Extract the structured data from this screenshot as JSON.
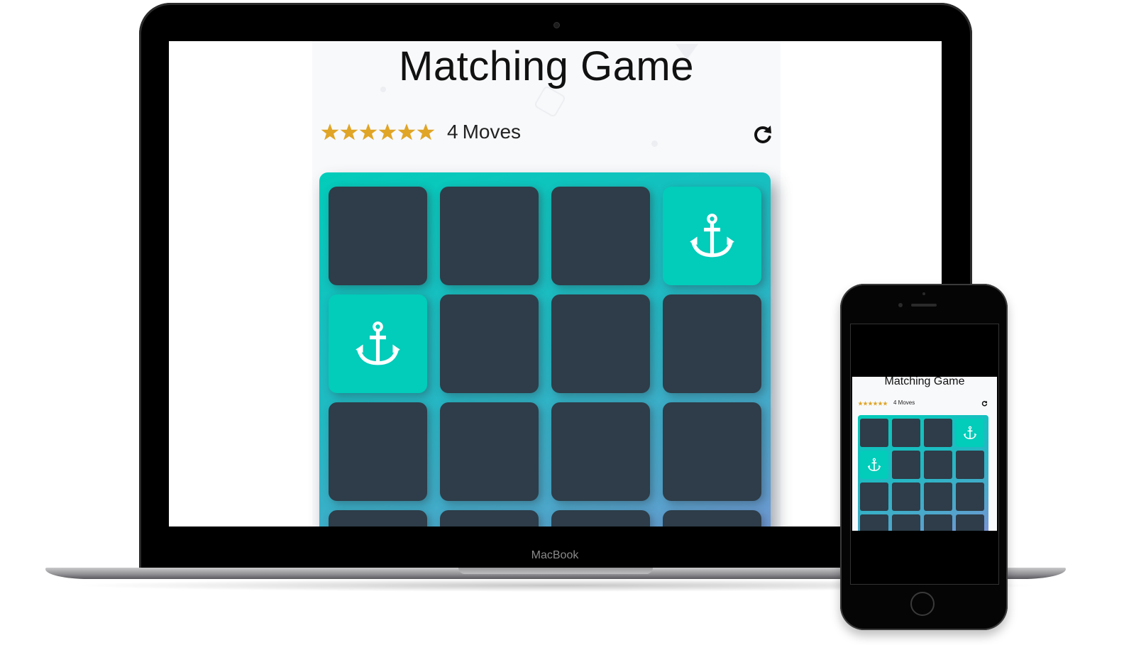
{
  "laptop": {
    "brand": "MacBook"
  },
  "game": {
    "title": "Matching Game",
    "stars": 6,
    "moves_count": "4",
    "moves_label": "Moves",
    "restart_icon": "restart-icon",
    "cards": [
      {
        "state": "closed",
        "icon": ""
      },
      {
        "state": "closed",
        "icon": ""
      },
      {
        "state": "closed",
        "icon": ""
      },
      {
        "state": "open",
        "icon": "anchor-icon"
      },
      {
        "state": "open",
        "icon": "anchor-icon"
      },
      {
        "state": "closed",
        "icon": ""
      },
      {
        "state": "closed",
        "icon": ""
      },
      {
        "state": "closed",
        "icon": ""
      },
      {
        "state": "closed",
        "icon": ""
      },
      {
        "state": "closed",
        "icon": ""
      },
      {
        "state": "closed",
        "icon": ""
      },
      {
        "state": "closed",
        "icon": ""
      },
      {
        "state": "closed",
        "icon": ""
      },
      {
        "state": "closed",
        "icon": ""
      },
      {
        "state": "closed",
        "icon": ""
      },
      {
        "state": "closed",
        "icon": ""
      }
    ],
    "colors": {
      "card_closed": "#2e3d49",
      "card_open": "#02ccba",
      "star": "#e0a526"
    }
  },
  "phone": {
    "title": "Matching Game",
    "moves_text": "4 Moves"
  }
}
